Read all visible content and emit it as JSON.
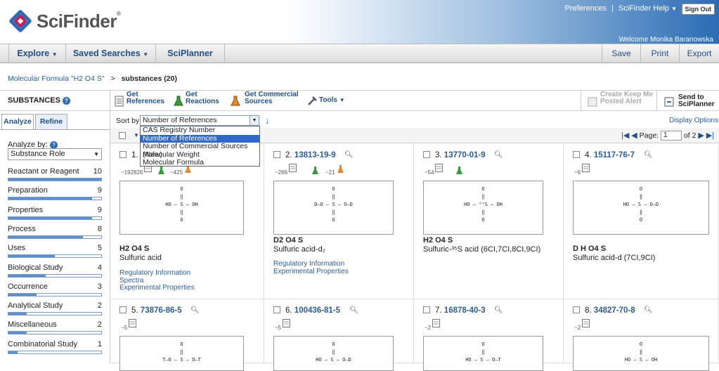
{
  "header": {
    "logo": "SciFinder",
    "logo_mark": "®",
    "preferences": "Preferences",
    "separator": "|",
    "help": "SciFinder Help",
    "sign_out": "Sign Out",
    "welcome": "Welcome Monika Baranowska"
  },
  "nav": {
    "explore": "Explore",
    "saved_searches": "Saved Searches",
    "sciplanner": "SciPlanner",
    "save": "Save",
    "print": "Print",
    "export": "Export"
  },
  "breadcrumb": {
    "query": "Molecular Formula \"H2 O4 S\"",
    "sep": ">",
    "current": "substances (20)"
  },
  "toolbar": {
    "substances": "SUBSTANCES",
    "get_references": [
      "Get",
      "References"
    ],
    "get_reactions": [
      "Get",
      "Reactions"
    ],
    "get_commercial": [
      "Get Commercial",
      "Sources"
    ],
    "tools": "Tools",
    "create_keep_me": [
      "Create Keep Me",
      "Posted Alert"
    ],
    "send_to": [
      "Send to",
      "SciPlanner"
    ]
  },
  "sidebar": {
    "tab_analyze": "Analyze",
    "tab_refine": "Refine",
    "analyze_by": "Analyze by:",
    "select_value": "Substance Role",
    "facets": [
      {
        "label": "Reactant or Reagent",
        "count": "10",
        "frac": 1.0
      },
      {
        "label": "Preparation",
        "count": "9",
        "frac": 0.9
      },
      {
        "label": "Properties",
        "count": "9",
        "frac": 0.9
      },
      {
        "label": "Process",
        "count": "8",
        "frac": 0.8
      },
      {
        "label": "Uses",
        "count": "5",
        "frac": 0.5
      },
      {
        "label": "Biological Study",
        "count": "4",
        "frac": 0.4
      },
      {
        "label": "Occurrence",
        "count": "3",
        "frac": 0.3
      },
      {
        "label": "Analytical Study",
        "count": "2",
        "frac": 0.2
      },
      {
        "label": "Miscellaneous",
        "count": "2",
        "frac": 0.2
      },
      {
        "label": "Combinatorial Study",
        "count": "1",
        "frac": 0.1
      }
    ]
  },
  "sort": {
    "label": "Sort by:",
    "value": "Number of References",
    "options": [
      "CAS Registry Number",
      "Number of References",
      "Number of Commercial Sources (New)",
      "Molecular Weight",
      "Molecular Formula"
    ],
    "display_options": "Display Options"
  },
  "pager": {
    "label": "Page:",
    "value": "1",
    "of": "of 2"
  },
  "results": [
    {
      "n": "1.",
      "cas": "",
      "refs": "~192826",
      "rx": "~425",
      "formula": "H2 O4 S",
      "name": "Sulfuric acid",
      "links": [
        "Regulatory Information",
        "Spectra",
        "Experimental Properties"
      ],
      "struct": [
        "O",
        "‖",
        "HO — S — OH",
        "‖",
        "O"
      ]
    },
    {
      "n": "2.",
      "cas": "13813-19-9",
      "refs": "~266",
      "rx": "~21",
      "formula": "D2 O4 S",
      "name": "Sulfuric acid-d₂",
      "links": [
        "Regulatory Information",
        "Experimental Properties"
      ],
      "struct": [
        "O",
        "‖",
        "D—O — S — O—D",
        "‖",
        "O"
      ]
    },
    {
      "n": "3.",
      "cas": "13770-01-9",
      "refs": "~54",
      "rx": "",
      "formula": "H2 O4 S",
      "name": "Sulfuric-³⁵S acid (6CI,7CI,8CI,9CI)",
      "links": [],
      "struct": [
        "O",
        "‖",
        "HO — ³⁵S — OH",
        "‖",
        "O"
      ]
    },
    {
      "n": "4.",
      "cas": "15117-76-7",
      "refs": "~6",
      "rx": "",
      "formula": "D H O4 S",
      "name": "Sulfuric acid-d (7CI,9CI)",
      "links": [],
      "struct": [
        "O",
        "‖",
        "HO — S — O—D",
        "‖",
        "O"
      ]
    },
    {
      "n": "5.",
      "cas": "73876-86-5",
      "refs": "~5",
      "rx": "",
      "formula": "",
      "name": "",
      "links": [],
      "struct": [
        "O",
        "‖",
        "T—O — S — O—T"
      ]
    },
    {
      "n": "6.",
      "cas": "100436-81-5",
      "refs": "~5",
      "rx": "",
      "formula": "",
      "name": "",
      "links": [],
      "struct": [
        "O",
        "‖",
        "HO — S — O—D"
      ]
    },
    {
      "n": "7.",
      "cas": "16878-40-3",
      "refs": "~2",
      "rx": "",
      "formula": "",
      "name": "",
      "links": [],
      "struct": [
        "O",
        "‖",
        "HO — S — O—T"
      ]
    },
    {
      "n": "8.",
      "cas": "34827-70-8",
      "refs": "~2",
      "rx": "",
      "formula": "",
      "name": "",
      "links": [],
      "struct": [
        "O",
        "‖",
        "HO — S — OH"
      ]
    }
  ]
}
